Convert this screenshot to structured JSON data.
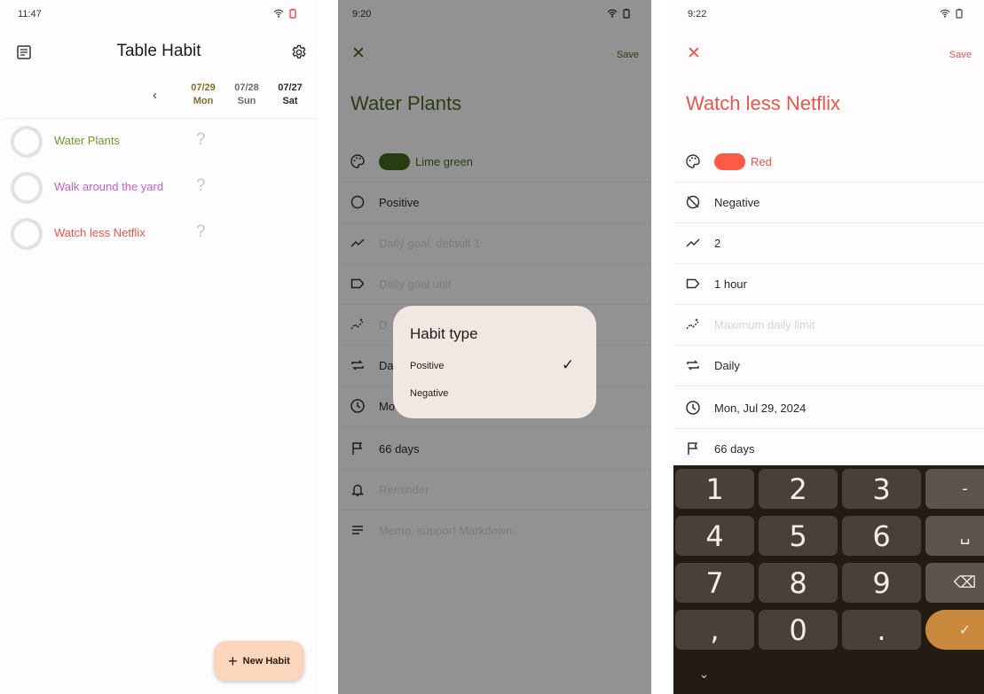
{
  "screen1": {
    "status_time": "11:47",
    "title": "Table Habit",
    "dates": [
      {
        "date": "07/29",
        "day": "Mon",
        "color": "#8a6a2a"
      },
      {
        "date": "07/28",
        "day": "Sun",
        "color": "#6b6b6b"
      },
      {
        "date": "07/27",
        "day": "Sat",
        "color": "#2b2b2b"
      }
    ],
    "habits": [
      {
        "name": "Water Plants",
        "color": "#6c9a2f",
        "status": "?"
      },
      {
        "name": "Walk around the yard",
        "color": "#c05fcf",
        "status": "?"
      },
      {
        "name": "Watch less Netflix",
        "color": "#e0574a",
        "status": "?"
      }
    ],
    "fab_label": "New Habit"
  },
  "screen2": {
    "status_time": "9:20",
    "save_label": "Save",
    "habit_title": "Water Plants",
    "accent": "#496a1f",
    "color_name": "Lime green",
    "color_value": "#436a1c",
    "fields": {
      "type": "Positive",
      "daily_goal": "Daily goal, default 1",
      "goal_unit": "Daily goal unit",
      "max_limit": "D",
      "frequency": "Da",
      "start_date": "Mo",
      "target": "66 days",
      "reminder": "Reminder",
      "memo": "Memo, support Markdown"
    },
    "dialog": {
      "title": "Habit type",
      "options": [
        "Positive",
        "Negative"
      ],
      "selected": "Positive"
    }
  },
  "screen3": {
    "status_time": "9:22",
    "save_label": "Save",
    "habit_title": "Watch less Netflix",
    "accent": "#e4574b",
    "color_name": "Red",
    "color_value": "#fe5a48",
    "fields": {
      "type": "Negative",
      "daily_goal": "2",
      "goal_unit": "1 hour",
      "max_limit": "Maximum daily limit",
      "frequency": "Daily",
      "start_date": "Mon, Jul 29, 2024",
      "target": "66 days"
    },
    "keyboard": {
      "rows": [
        [
          "1",
          "2",
          "3",
          "-"
        ],
        [
          "4",
          "5",
          "6",
          "␣"
        ],
        [
          "7",
          "8",
          "9",
          "⌫"
        ],
        [
          ",",
          "0",
          ".",
          "✓"
        ]
      ],
      "hide": "⌄"
    }
  }
}
